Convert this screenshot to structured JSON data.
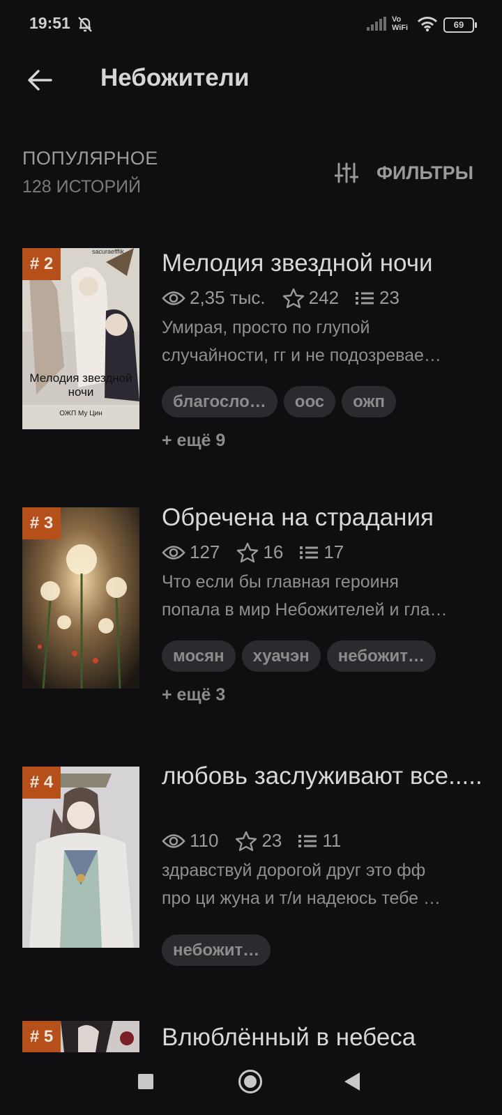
{
  "status_bar": {
    "time": "19:51",
    "network": "Vo WiFi",
    "network_line1": "Vo",
    "network_line2": "WiFi",
    "battery": "69"
  },
  "app_bar": {
    "title": "Небожители",
    "back_icon": "arrow-left-icon"
  },
  "section": {
    "title": "ПОПУЛЯРНОЕ",
    "count": "128 ИСТОРИЙ",
    "filters_label": "ФИЛЬТРЫ",
    "filters_icon": "sliders-icon"
  },
  "stories": [
    {
      "rank": "# 2",
      "title": "Мелодия звездной ночи",
      "views": "2,35 тыс.",
      "stars": "242",
      "chapters": "23",
      "description": [
        "Умирая, просто по глупой",
        "случайности, гг и не подозревае…"
      ],
      "tags": [
        "благосло…",
        "оос",
        "ожп"
      ],
      "more": "+ ещё 9",
      "cover_text": {
        "top": "sacuraefffik",
        "title": "Мелодия звездной ночи",
        "author": "ОЖП Му Цин"
      }
    },
    {
      "rank": "# 3",
      "title": "Обречена на страдания",
      "views": "127",
      "stars": "16",
      "chapters": "17",
      "description": [
        "Что если бы главная героиня",
        "попала в мир Небожителей и гла…"
      ],
      "tags": [
        "мосян",
        "хуачэн",
        "небожит…"
      ],
      "more": "+ ещё 3"
    },
    {
      "rank": "# 4",
      "title": "любовь заслуживают все.....",
      "views": "110",
      "stars": "23",
      "chapters": "11",
      "description": [
        "здравствуй дорогой друг это фф",
        "про ци жуна и т/и надеюсь тебе …"
      ],
      "tags": [
        "небожит…"
      ]
    },
    {
      "rank": "# 5",
      "title": "Влюблённый в небеса"
    }
  ],
  "icons": {
    "views": "eye-icon",
    "stars": "star-icon",
    "chapters": "list-icon"
  }
}
